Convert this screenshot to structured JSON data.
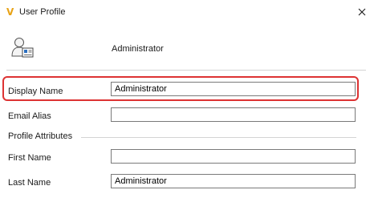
{
  "window": {
    "title": "User Profile",
    "app_icon": "V",
    "close_icon": "close-icon"
  },
  "user": {
    "icon": "user-card-icon",
    "name": "Administrator"
  },
  "fields": {
    "display_name": {
      "label": "Display Name",
      "value": "Administrator"
    },
    "email_alias": {
      "label": "Email Alias",
      "value": ""
    },
    "first_name": {
      "label": "First Name",
      "value": ""
    },
    "last_name": {
      "label": "Last Name",
      "value": "Administrator"
    }
  },
  "profile_attributes_label": "Profile Attributes",
  "colors": {
    "highlight": "#dd3333",
    "app_icon": "#e8a317",
    "input_border": "#7a7a7a"
  }
}
